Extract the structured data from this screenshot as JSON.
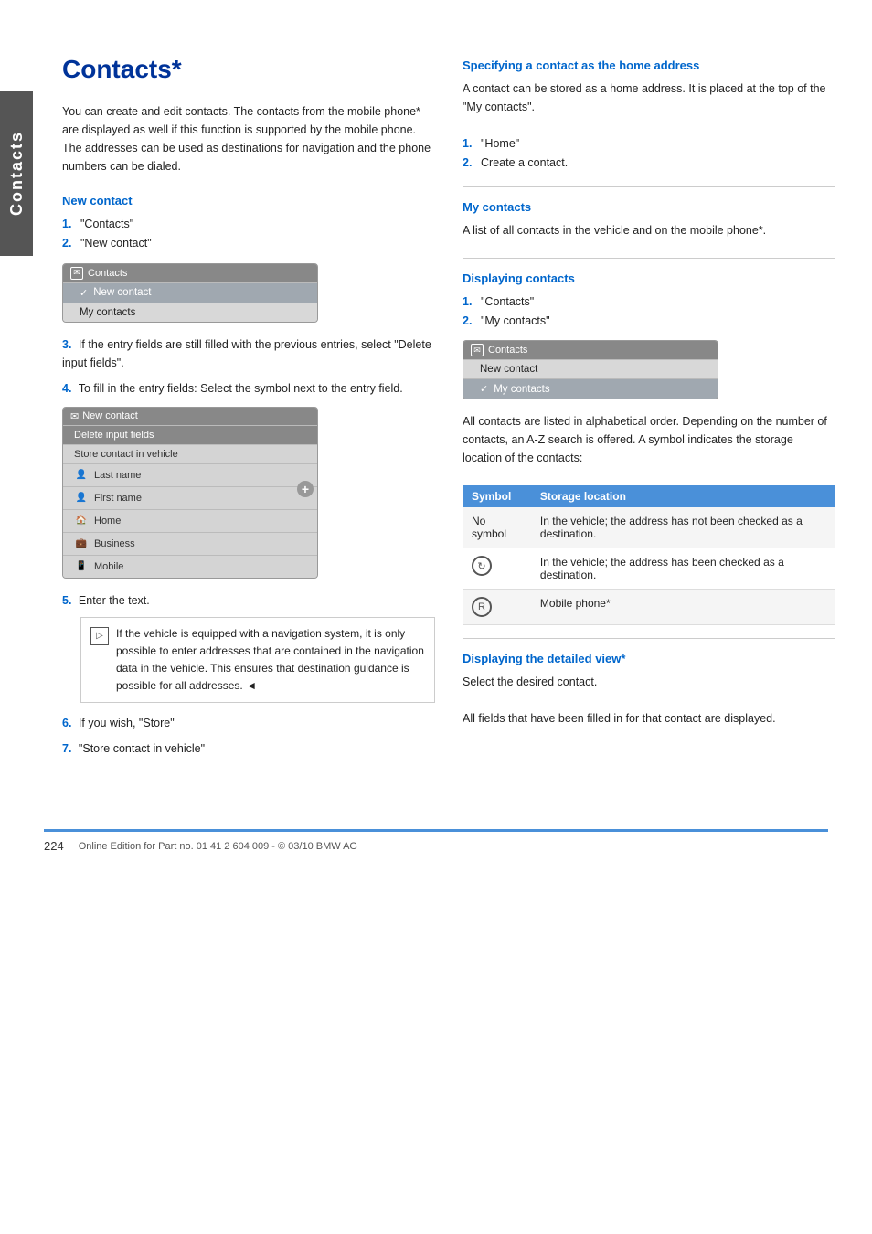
{
  "sidebar": {
    "label": "Contacts"
  },
  "page": {
    "title": "Contacts*",
    "intro": "You can create and edit contacts. The contacts from the mobile phone* are displayed as well if this function is supported by the mobile phone. The addresses can be used as destinations for navigation and the phone numbers can be dialed."
  },
  "sections": {
    "new_contact": {
      "heading": "New contact",
      "steps": [
        {
          "num": "1.",
          "text": "\"Contacts\""
        },
        {
          "num": "2.",
          "text": "\"New contact\""
        }
      ],
      "step3": {
        "num": "3.",
        "text": "If the entry fields are still filled with the previous entries, select \"Delete input fields\"."
      },
      "step4": {
        "num": "4.",
        "text": "To fill in the entry fields: Select the symbol next to the entry field."
      },
      "step5": {
        "num": "5.",
        "text": "Enter the text."
      },
      "note": "If the vehicle is equipped with a navigation system, it is only possible to enter addresses that are contained in the navigation data in the vehicle. This ensures that destination guidance is possible for all addresses.",
      "note_end": "◄",
      "step6": {
        "num": "6.",
        "text": "If you wish, \"Store\""
      },
      "step7": {
        "num": "7.",
        "text": "\"Store contact in vehicle\""
      }
    },
    "home_address": {
      "heading": "Specifying a contact as the home address",
      "intro": "A contact can be stored as a home address. It is placed at the top of the \"My contacts\".",
      "steps": [
        {
          "num": "1.",
          "text": "\"Home\""
        },
        {
          "num": "2.",
          "text": "Create a contact."
        }
      ]
    },
    "my_contacts": {
      "heading": "My contacts",
      "intro": "A list of all contacts in the vehicle and on the mobile phone*."
    },
    "displaying_contacts": {
      "heading": "Displaying contacts",
      "steps": [
        {
          "num": "1.",
          "text": "\"Contacts\""
        },
        {
          "num": "2.",
          "text": "\"My contacts\""
        }
      ],
      "desc": "All contacts are listed in alphabetical order. Depending on the number of contacts, an A-Z search is offered. A symbol indicates the storage location of the contacts:"
    },
    "displaying_detail": {
      "heading": "Displaying the detailed view*",
      "intro": "Select the desired contact.",
      "desc": "All fields that have been filled in for that contact are displayed."
    }
  },
  "mockup1": {
    "title": "Contacts",
    "rows": [
      {
        "text": "New contact",
        "selected": true,
        "check": true
      },
      {
        "text": "My contacts",
        "selected": false
      }
    ]
  },
  "mockup2": {
    "title": "New contact",
    "rows": [
      {
        "text": "Delete input fields",
        "selected": false,
        "hasIcon": false
      },
      {
        "text": "Store contact in vehicle",
        "selected": false,
        "hasIcon": false
      },
      {
        "text": "Last name",
        "selected": false,
        "hasIcon": true,
        "iconType": "person"
      },
      {
        "text": "First name",
        "selected": false,
        "hasIcon": true,
        "iconType": "person"
      },
      {
        "text": "Home",
        "selected": false,
        "hasIcon": true,
        "iconType": "home"
      },
      {
        "text": "Business",
        "selected": false,
        "hasIcon": true,
        "iconType": "business"
      },
      {
        "text": "Mobile",
        "selected": false,
        "hasIcon": true,
        "iconType": "mobile"
      }
    ]
  },
  "mockup3": {
    "title": "Contacts",
    "rows": [
      {
        "text": "New contact",
        "selected": false,
        "check": false
      },
      {
        "text": "My contacts",
        "selected": true,
        "check": true
      }
    ]
  },
  "symbol_table": {
    "headers": [
      "Symbol",
      "Storage location"
    ],
    "rows": [
      {
        "symbol": "No symbol",
        "location": "In the vehicle; the address has not been checked as a destination."
      },
      {
        "symbol": "circle-arrow",
        "location": "In the vehicle; the address has been checked as a destination."
      },
      {
        "symbol": "circle-r",
        "location": "Mobile phone*"
      }
    ]
  },
  "footer": {
    "page_number": "224",
    "copyright": "Online Edition for Part no. 01 41 2 604 009 - © 03/10 BMW AG"
  }
}
